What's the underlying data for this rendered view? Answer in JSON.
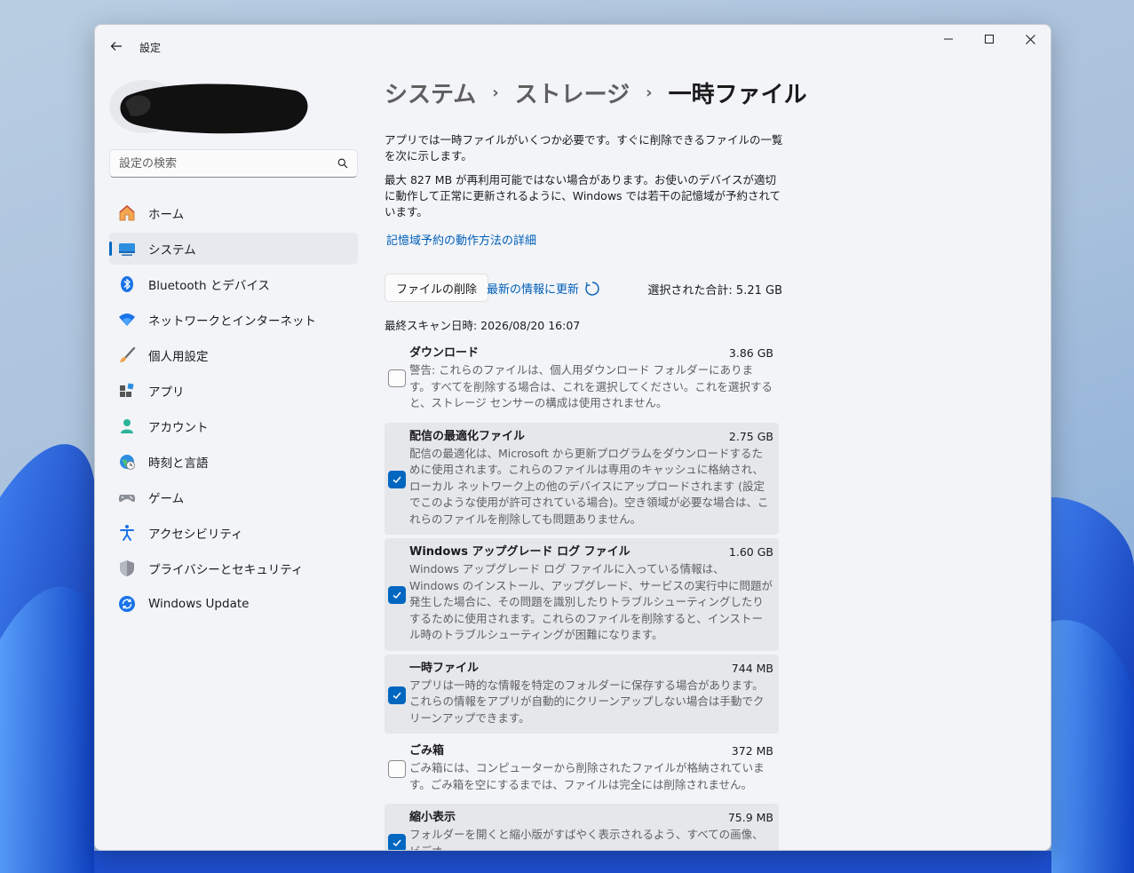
{
  "app": {
    "title": "設定"
  },
  "search": {
    "placeholder": "設定の検索"
  },
  "nav": {
    "items": [
      {
        "label": "ホーム",
        "icon": "home-icon"
      },
      {
        "label": "システム",
        "icon": "system-icon",
        "active": true
      },
      {
        "label": "Bluetooth とデバイス",
        "icon": "bluetooth-icon"
      },
      {
        "label": "ネットワークとインターネット",
        "icon": "wifi-icon"
      },
      {
        "label": "個人用設定",
        "icon": "brush-icon"
      },
      {
        "label": "アプリ",
        "icon": "apps-icon"
      },
      {
        "label": "アカウント",
        "icon": "account-icon"
      },
      {
        "label": "時刻と言語",
        "icon": "globe-clock-icon"
      },
      {
        "label": "ゲーム",
        "icon": "gamepad-icon"
      },
      {
        "label": "アクセシビリティ",
        "icon": "accessibility-icon"
      },
      {
        "label": "プライバシーとセキュリティ",
        "icon": "shield-icon"
      },
      {
        "label": "Windows Update",
        "icon": "update-icon"
      }
    ]
  },
  "breadcrumb": {
    "part1": "システム",
    "part2": "ストレージ",
    "current": "一時ファイル",
    "separator": "›"
  },
  "main": {
    "desc1": "アプリでは一時ファイルがいくつか必要です。すぐに削除できるファイルの一覧を次に示します。",
    "desc2": "最大 827 MB が再利用可能ではない場合があります。お使いのデバイスが適切に動作して正常に更新されるように、Windows では若干の記憶域が予約されています。",
    "link": "記憶域予約の動作方法の詳細",
    "delete_button": "ファイルの削除",
    "refresh_label": "最新の情報に更新",
    "total": "選択された合計: 5.21 GB",
    "last_scan": "最終スキャン日時: 2026/08/20 16:07"
  },
  "items": [
    {
      "name": "ダウンロード",
      "size": "3.86 GB",
      "checked": false,
      "desc": "警告: これらのファイルは、個人用ダウンロード フォルダーにあります。すべてを削除する場合は、これを選択してください。これを選択すると、ストレージ センサーの構成は使用されません。"
    },
    {
      "name": "配信の最適化ファイル",
      "size": "2.75 GB",
      "checked": true,
      "desc": "配信の最適化は、Microsoft から更新プログラムをダウンロードするために使用されます。これらのファイルは専用のキャッシュに格納され、ローカル ネットワーク上の他のデバイスにアップロードされます (設定でこのような使用が許可されている場合)。空き領域が必要な場合は、これらのファイルを削除しても問題ありません。"
    },
    {
      "name": "Windows アップグレード ログ ファイル",
      "size": "1.60 GB",
      "checked": true,
      "desc": "Windows アップグレード ログ ファイルに入っている情報は、Windows のインストール、アップグレード、サービスの実行中に問題が発生した場合に、その問題を識別したりトラブルシューティングしたりするために使用されます。これらのファイルを削除すると、インストール時のトラブルシューティングが困難になります。"
    },
    {
      "name": "一時ファイル",
      "size": "744 MB",
      "checked": true,
      "desc": "アプリは一時的な情報を特定のフォルダーに保存する場合があります。これらの情報をアプリが自動的にクリーンアップしない場合は手動でクリーンアップできます。"
    },
    {
      "name": "ごみ箱",
      "size": "372 MB",
      "checked": false,
      "desc": "ごみ箱には、コンピューターから削除されたファイルが格納されています。ごみ箱を空にするまでは、ファイルは完全には削除されません。"
    },
    {
      "name": "縮小表示",
      "size": "75.9 MB",
      "checked": true,
      "desc": "フォルダーを開くと縮小版がすばやく表示されるよう、すべての画像、ビデオ、"
    }
  ],
  "colors": {
    "accent": "#0067c0",
    "link": "#005fb8",
    "window_bg": "#f2f4f8"
  }
}
